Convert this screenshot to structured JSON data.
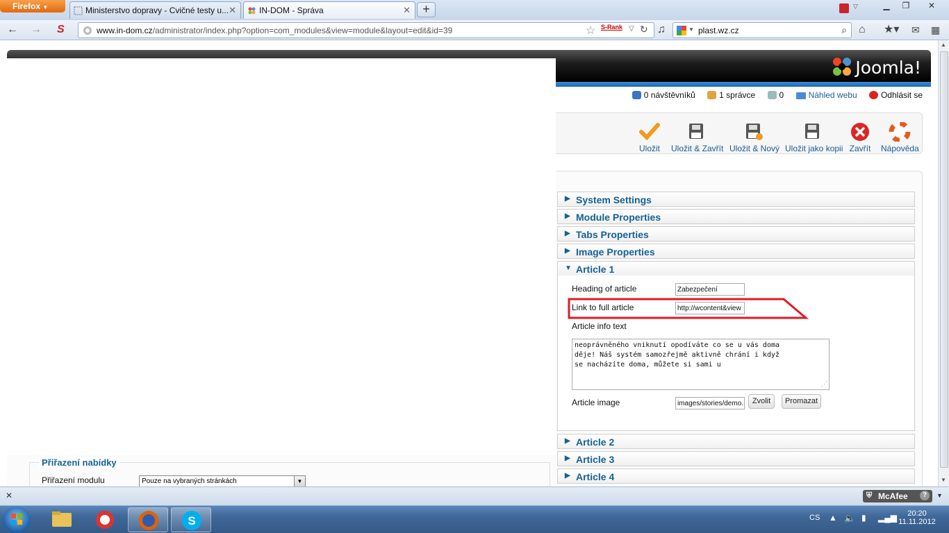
{
  "browser": {
    "menu_button": "Firefox",
    "tabs": [
      {
        "title": "Ministerstvo dopravy - Cvičné testy u..."
      },
      {
        "title": "IN-DOM - Správa"
      }
    ],
    "url_host": "www.in-dom.cz",
    "url_path": "/administrator/index.php?option=com_modules&view=module&layout=edit&id=39",
    "srank_label": "S-Rank",
    "search_value": "plast.wz.cz",
    "mcafee_label": "McAfee"
  },
  "joomla": {
    "logo_text": "Joomla!",
    "status": {
      "visitors": "0 návštěvníků",
      "admins": "1 správce",
      "messages": "0",
      "preview": "Náhled webu",
      "logout": "Odhlásit se"
    },
    "toolbar": {
      "save": "Uložit",
      "save_close": "Uložit & Zavřít",
      "save_new": "Uložit & Nový",
      "save_copy": "Uložit jako kopii",
      "close": "Zavřít",
      "help": "Nápověda"
    },
    "accordion": {
      "system": "System Settings",
      "module": "Module Properties",
      "tabs": "Tabs Properties",
      "image": "Image Properties",
      "article1": "Article 1",
      "article2": "Article 2",
      "article3": "Article 3",
      "article4": "Article 4"
    },
    "article1": {
      "heading_label": "Heading of article",
      "heading_value": "Zabezpečení",
      "link_label": "Link to full article",
      "link_value": "http://wcontent&view",
      "info_label": "Article info text",
      "info_lines": [
        "neoprávněného vniknutí opodíváte co se u vás doma",
        "děje! Náš systém samozřejmě aktivně chrání i když",
        "se  nacházíte doma, můžete si sami u"
      ],
      "image_label": "Article image",
      "image_value": "images/stories/demo.",
      "choose_button": "Zvolit",
      "clear_button": "Promazat"
    },
    "menu_assign": {
      "legend": "Přiřazení nabídky",
      "label": "Přiřazení modulu",
      "selected": "Pouze na vybraných stránkách"
    }
  },
  "taskbar": {
    "lang": "CS",
    "time": "20:20",
    "date": "11.11.2012"
  }
}
